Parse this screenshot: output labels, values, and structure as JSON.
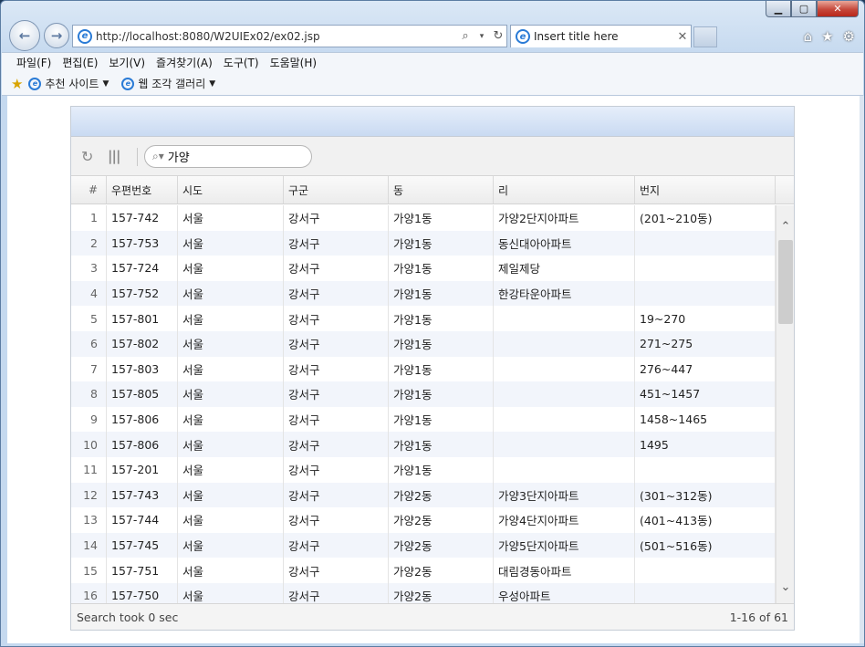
{
  "browser": {
    "address_url": "http://localhost:8080/W2UIEx02/ex02.jsp",
    "tab_title": "Insert title here",
    "menu": [
      "파일(F)",
      "편집(E)",
      "보기(V)",
      "즐겨찾기(A)",
      "도구(T)",
      "도움말(H)"
    ],
    "favorites": [
      {
        "label": "추천 사이트"
      },
      {
        "label": "웹 조각 갤러리"
      }
    ]
  },
  "grid": {
    "search_value": "가양",
    "columns": [
      "#",
      "우편번호",
      "시도",
      "구군",
      "동",
      "리",
      "번지"
    ],
    "rows": [
      [
        "1",
        "157-742",
        "서울",
        "강서구",
        "가양1동",
        "가양2단지아파트",
        "(201~210동)"
      ],
      [
        "2",
        "157-753",
        "서울",
        "강서구",
        "가양1동",
        "동신대아아파트",
        ""
      ],
      [
        "3",
        "157-724",
        "서울",
        "강서구",
        "가양1동",
        "제일제당",
        ""
      ],
      [
        "4",
        "157-752",
        "서울",
        "강서구",
        "가양1동",
        "한강타운아파트",
        ""
      ],
      [
        "5",
        "157-801",
        "서울",
        "강서구",
        "가양1동",
        "",
        "19~270"
      ],
      [
        "6",
        "157-802",
        "서울",
        "강서구",
        "가양1동",
        "",
        "271~275"
      ],
      [
        "7",
        "157-803",
        "서울",
        "강서구",
        "가양1동",
        "",
        "276~447"
      ],
      [
        "8",
        "157-805",
        "서울",
        "강서구",
        "가양1동",
        "",
        "451~1457"
      ],
      [
        "9",
        "157-806",
        "서울",
        "강서구",
        "가양1동",
        "",
        "1458~1465"
      ],
      [
        "10",
        "157-806",
        "서울",
        "강서구",
        "가양1동",
        "",
        "1495"
      ],
      [
        "11",
        "157-201",
        "서울",
        "강서구",
        "가양1동",
        "",
        ""
      ],
      [
        "12",
        "157-743",
        "서울",
        "강서구",
        "가양2동",
        "가양3단지아파트",
        "(301~312동)"
      ],
      [
        "13",
        "157-744",
        "서울",
        "강서구",
        "가양2동",
        "가양4단지아파트",
        "(401~413동)"
      ],
      [
        "14",
        "157-745",
        "서울",
        "강서구",
        "가양2동",
        "가양5단지아파트",
        "(501~516동)"
      ],
      [
        "15",
        "157-751",
        "서울",
        "강서구",
        "가양2동",
        "대림경동아파트",
        ""
      ],
      [
        "16",
        "157-750",
        "서울",
        "강서구",
        "가양2동",
        "우성아파트",
        ""
      ]
    ],
    "footer_left": "Search took 0 sec",
    "footer_right": "1-16 of 61"
  }
}
